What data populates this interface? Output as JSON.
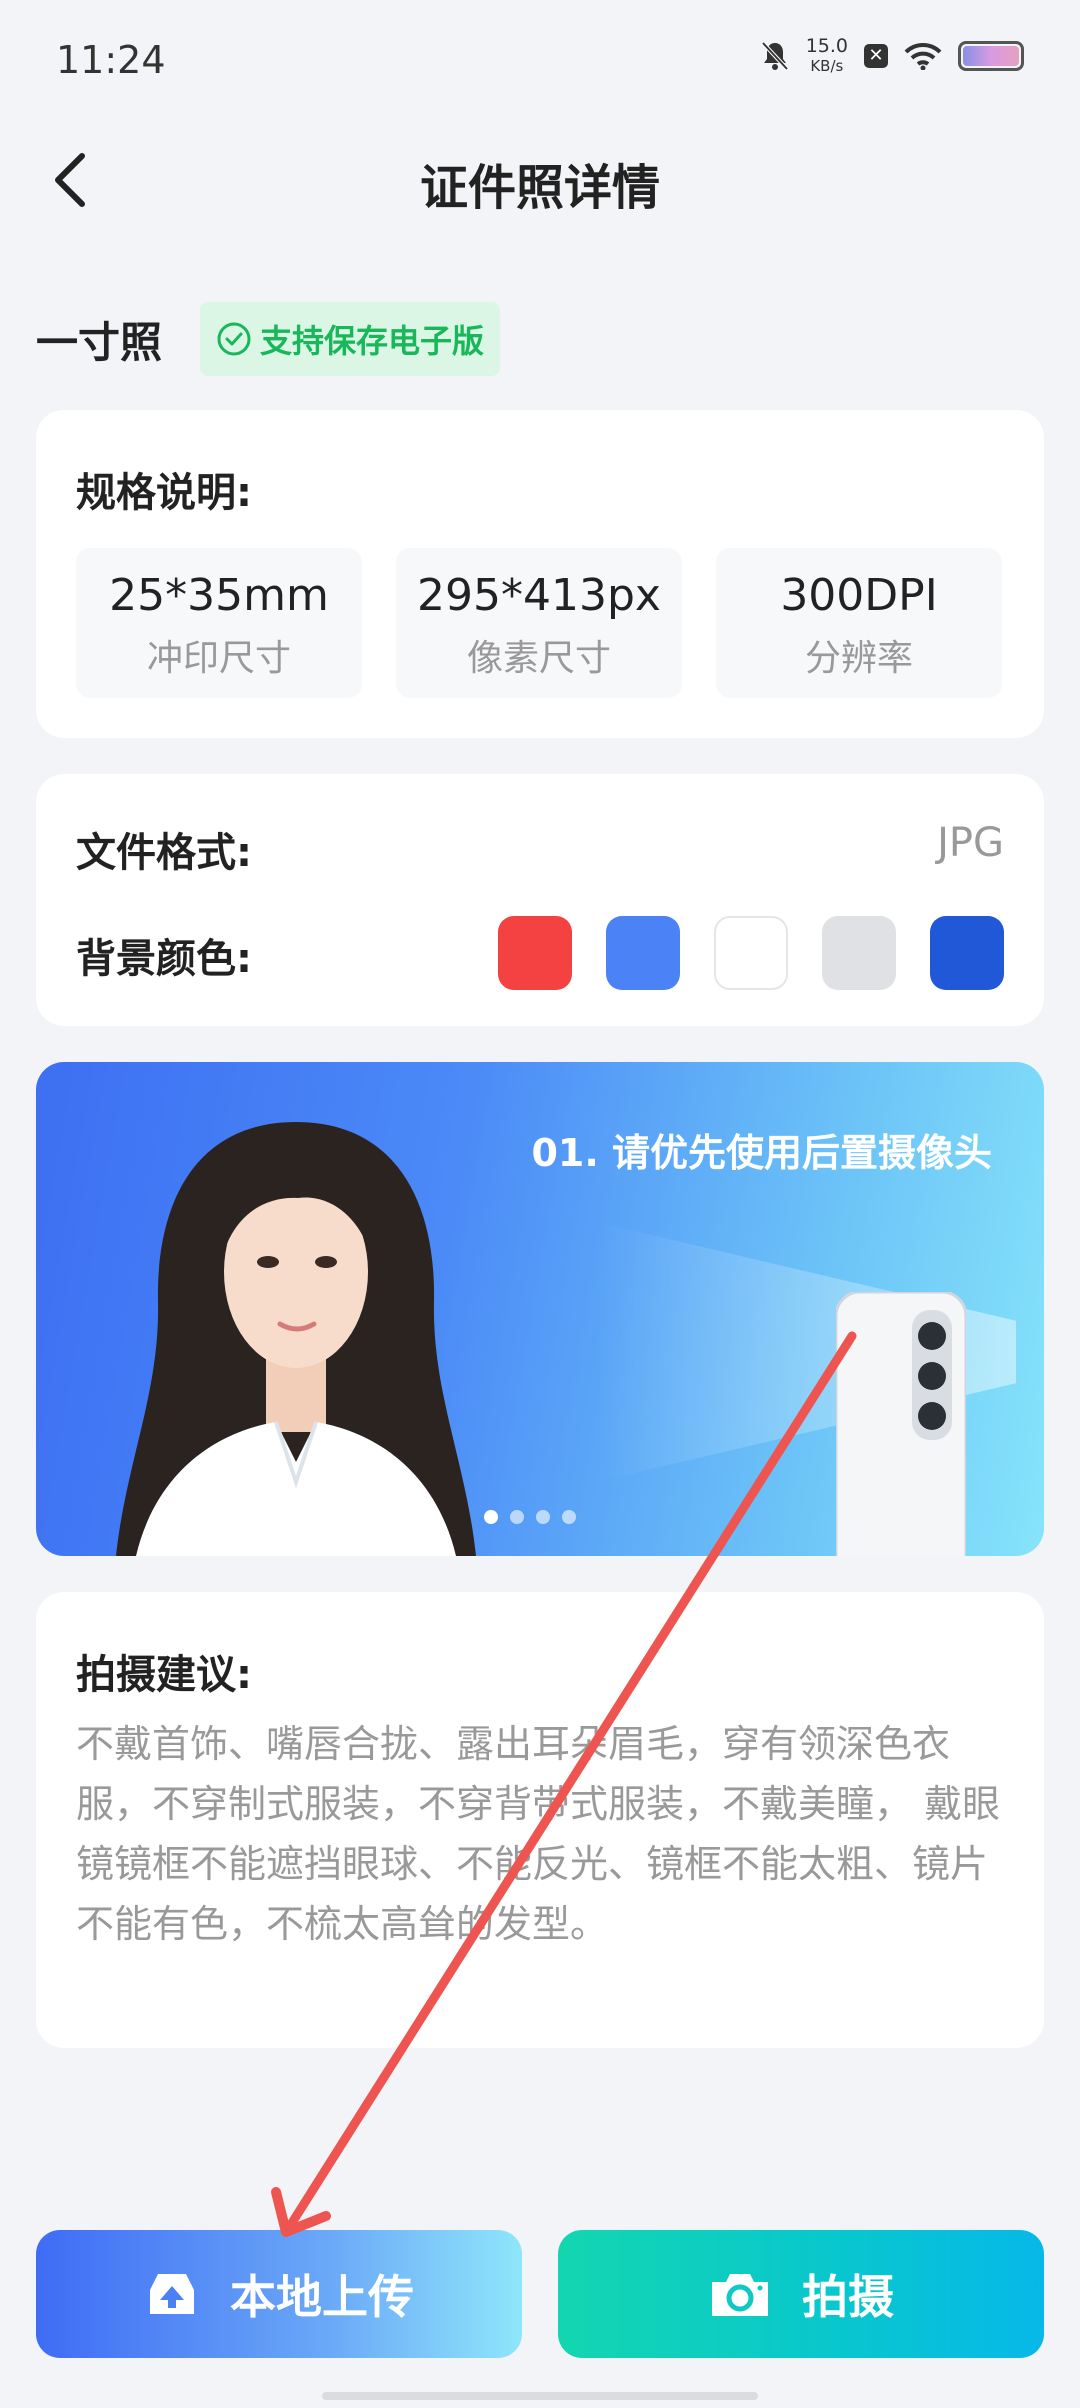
{
  "status_bar": {
    "time": "11:24",
    "speed_value": "15.0",
    "speed_unit": "KB/s"
  },
  "header": {
    "title": "证件照详情"
  },
  "photo_size": {
    "name": "一寸照",
    "badge": "支持保存电子版"
  },
  "spec": {
    "heading": "规格说明:",
    "items": [
      {
        "value": "25*35mm",
        "label": "冲印尺寸"
      },
      {
        "value": "295*413px",
        "label": "像素尺寸"
      },
      {
        "value": "300DPI",
        "label": "分辨率"
      }
    ]
  },
  "format": {
    "label": "文件格式:",
    "value": "JPG",
    "bg_label": "背景颜色:",
    "colors": [
      "#f44141",
      "#4b82f5",
      "#ffffff",
      "#e0e1e4",
      "#2158d8"
    ]
  },
  "banner": {
    "caption": "01. 请优先使用后置摄像头",
    "page_count": 4,
    "active_page": 1
  },
  "tips": {
    "heading": "拍摄建议:",
    "text": "不戴首饰、嘴唇合拢、露出耳朵眉毛，穿有领深色衣服，不穿制式服装，不穿背带式服装，不戴美瞳， 戴眼镜镜框不能遮挡眼球、不能反光、镜框不能太粗、镜片不能有色，不梳太高耸的发型。"
  },
  "actions": {
    "upload_label": "本地上传",
    "shoot_label": "拍摄"
  },
  "colors": {
    "accent_blue": "#3f6cf5",
    "accent_teal": "#13d6b0",
    "badge_green": "#18b85a"
  }
}
